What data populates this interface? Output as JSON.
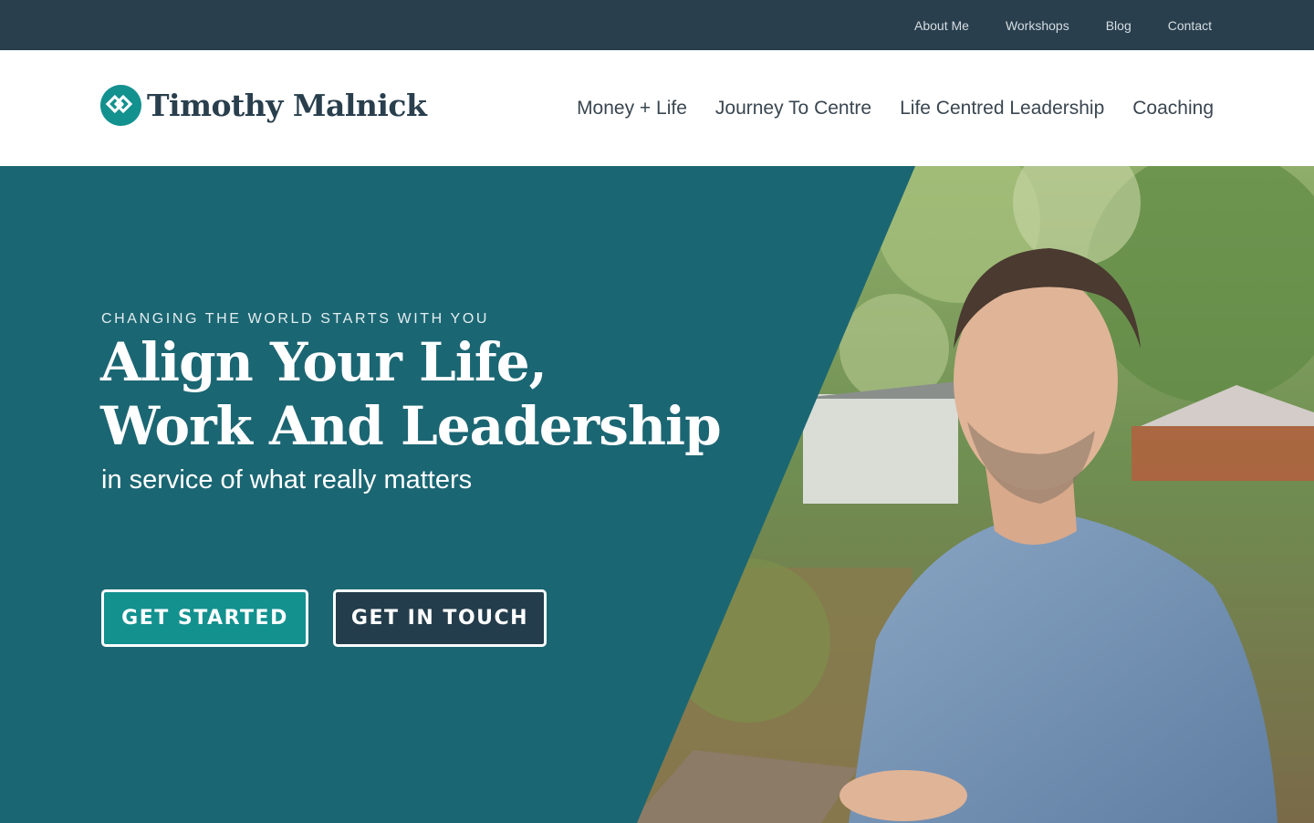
{
  "topbar": {
    "links": [
      "About Me",
      "Workshops",
      "Blog",
      "Contact"
    ]
  },
  "brand": {
    "name": "Timothy Malnick",
    "logo_icon": "diamond-knot-logo",
    "logo_color": "#13918f"
  },
  "main_nav": {
    "links": [
      "Money + Life",
      "Journey To Centre",
      "Life Centred Leadership",
      "Coaching"
    ]
  },
  "hero": {
    "eyebrow": "CHANGING THE WORLD STARTS WITH YOU",
    "headline_line1": "Align Your Life,",
    "headline_line2": "Work And Leadership",
    "subhead": "in service of what really matters",
    "primary_button": "GET STARTED",
    "secondary_button": "GET IN TOUCH"
  },
  "colors": {
    "topbar": "#293f4d",
    "hero_panel": "#1b6673",
    "primary_button": "#13918f",
    "secondary_button": "#243d4c"
  }
}
